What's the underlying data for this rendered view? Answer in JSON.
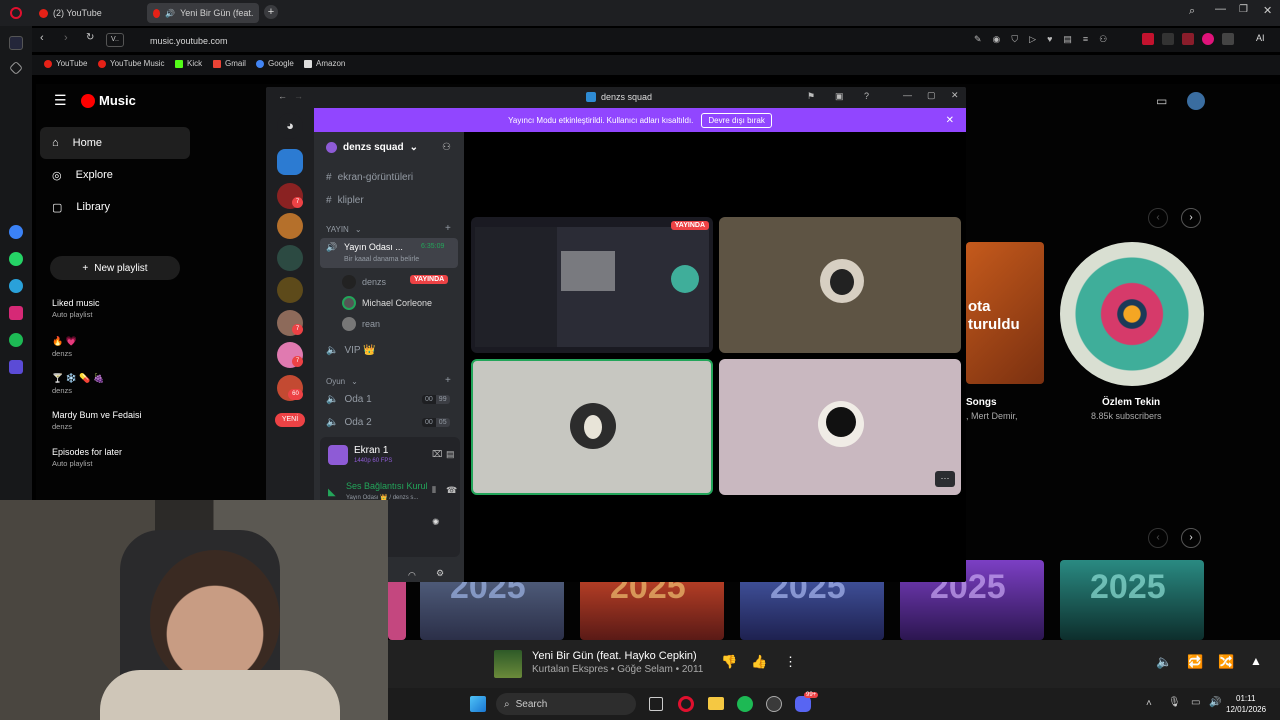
{
  "browser": {
    "tabs": [
      {
        "label": "(2) YouTube"
      },
      {
        "label": "Yeni Bir Gün (feat. Hay"
      }
    ],
    "address": "music.youtube.com",
    "site_badge": "V..",
    "ai_label": "AI",
    "bookmarks": [
      "YouTube",
      "YouTube Music",
      "Kick",
      "Gmail",
      "Google",
      "Amazon"
    ]
  },
  "ytmusic": {
    "logo": "Music",
    "nav": [
      {
        "label": "Home"
      },
      {
        "label": "Explore"
      },
      {
        "label": "Library"
      }
    ],
    "new_playlist": "New playlist",
    "playlists": [
      {
        "title": "Liked music",
        "subtitle": "Auto playlist"
      },
      {
        "title": "🔥 💗",
        "subtitle": "denzs"
      },
      {
        "title": "🍸 ❄️ 💊 🍇",
        "subtitle": "denzs"
      },
      {
        "title": "Mardy Bum ve Fedaisi",
        "subtitle": "denzs"
      },
      {
        "title": "Episodes for later",
        "subtitle": "Auto playlist"
      }
    ],
    "card_partial": {
      "line1": "ota",
      "line2": "turuldu"
    },
    "songs_card": {
      "title": "Songs",
      "subtitle": ", Mert Demir,"
    },
    "artist_card": {
      "title": "Özlem Tekin",
      "subtitle": "8.85k subscribers"
    },
    "shelf_labels": [
      "2025",
      "2025",
      "2025",
      "2025",
      "2025"
    ],
    "colors": {
      "accent": "#ff0000",
      "bg": "#030303"
    }
  },
  "discord": {
    "window_title": "denzs squad",
    "banner_text": "Yayıncı Modu etkinleştirildi. Kullanıcı adları kısaltıldı.",
    "banner_button": "Devre dışı bırak",
    "server_name": "denzs squad",
    "channels": {
      "text": [
        "ekran-görüntüleri",
        "klipler"
      ],
      "category_yayin": "YAYIN",
      "voice_active": {
        "name": "Yayın Odası ...",
        "timer": "6:35:09",
        "status": "Bir kaaal danama belirle"
      },
      "members": [
        {
          "name": "denzs",
          "badge": "YAYINDA"
        },
        {
          "name": "Michael Corleone"
        },
        {
          "name": "rean"
        }
      ],
      "vip": "VIP 👑",
      "category_oyun": "Oyun",
      "oda": [
        {
          "name": "Oda 1",
          "count": "00",
          "limit": "99"
        },
        {
          "name": "Oda 2",
          "count": "00",
          "limit": "05"
        }
      ]
    },
    "new_badge": "YENİ",
    "stream_panel": {
      "title": "Ekran 1",
      "subtitle": "1440p 60 FPS"
    },
    "voice_status": {
      "title": "Ses Bağlantısı Kurul",
      "subtitle": "Yayın Odası 👑 / denzs s..."
    },
    "live_badge": "YAYINDA",
    "server_badges": [
      "7",
      "7",
      "7",
      "60"
    ],
    "colors": {
      "brand": "#5865f2",
      "banner": "#9146ff",
      "live": "#ed4245",
      "connected": "#23a55a"
    }
  },
  "player": {
    "title": "Yeni Bir Gün (feat. Hayko Cepkin)",
    "subtitle": "Kurtalan Ekspres • Göğe Selam • 2011"
  },
  "taskbar": {
    "search_placeholder": "Search",
    "time": "01:11",
    "date": "12/01/2026",
    "discord_badge": "99+"
  }
}
